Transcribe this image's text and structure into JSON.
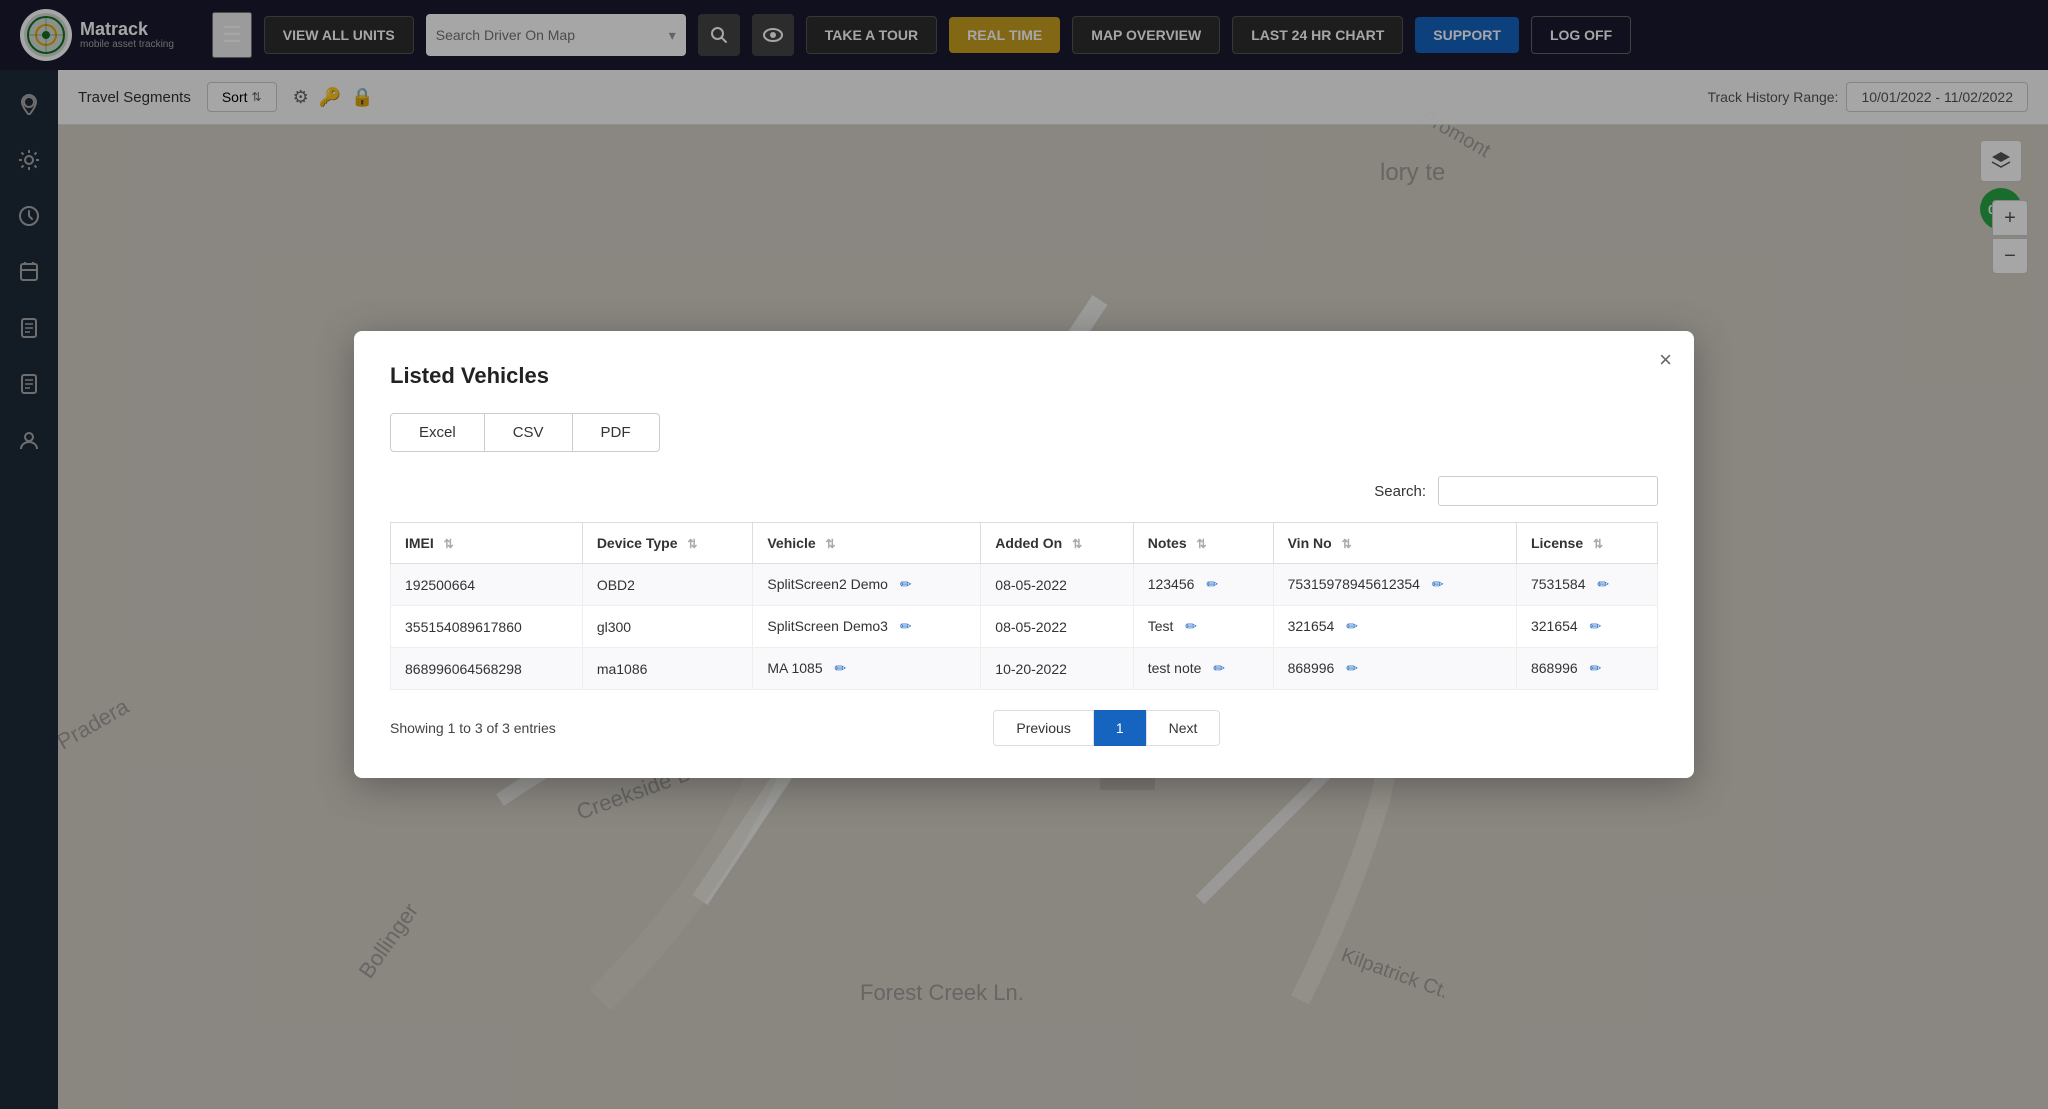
{
  "navbar": {
    "brand": "Matrack",
    "brand_sub": "mobile asset tracking",
    "buttons": {
      "view_all": "VIEW ALL UNITS",
      "search_placeholder": "Search Driver On Map",
      "take_tour": "TAKE A TOUR",
      "real_time": "REAL TIME",
      "map_overview": "MAP OVERVIEW",
      "last_24hr": "LAST 24 HR CHART",
      "support": "SUPPORT",
      "log_off": "LOG OFF"
    }
  },
  "track_bar": {
    "label": "Travel Segments",
    "sort": "Sort",
    "track_range_label": "Track History Range:",
    "track_range_value": "10/01/2022 - 11/02/2022"
  },
  "modal": {
    "title": "Listed Vehicles",
    "close_label": "×",
    "export": {
      "excel": "Excel",
      "csv": "CSV",
      "pdf": "PDF"
    },
    "search_label": "Search:",
    "search_placeholder": "",
    "table": {
      "columns": [
        "IMEI",
        "Device Type",
        "Vehicle",
        "Added On",
        "Notes",
        "Vin No",
        "License"
      ],
      "rows": [
        {
          "imei": "192500664",
          "device_type": "OBD2",
          "vehicle": "SplitScreen2 Demo",
          "added_on": "08-05-2022",
          "notes": "123456",
          "vin_no": "75315978945612354",
          "license": "7531584"
        },
        {
          "imei": "355154089617860",
          "device_type": "gl300",
          "vehicle": "SplitScreen Demo3",
          "added_on": "08-05-2022",
          "notes": "Test",
          "vin_no": "321654",
          "license": "321654"
        },
        {
          "imei": "868996064568298",
          "device_type": "ma1086",
          "vehicle": "MA 1085",
          "added_on": "10-20-2022",
          "notes": "test note",
          "vin_no": "868996",
          "license": "868996"
        }
      ]
    },
    "showing_text": "Showing 1 to 3 of 3 entries",
    "pagination": {
      "previous": "Previous",
      "current_page": "1",
      "next": "Next"
    }
  },
  "sidebar": {
    "icons": [
      "map-marker",
      "settings",
      "history",
      "clock",
      "document",
      "document2",
      "user"
    ]
  },
  "map": {
    "timer": "0:03"
  }
}
